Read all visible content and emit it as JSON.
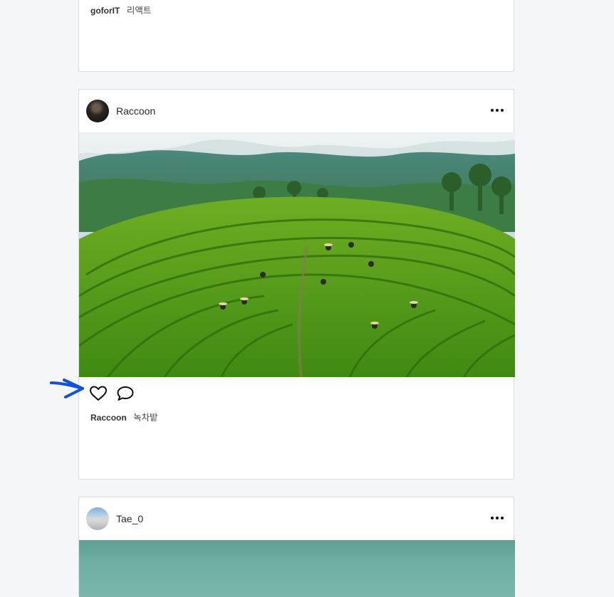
{
  "posts": [
    {
      "username": "goforIT",
      "caption_user": "goforIT",
      "caption_text": "리액트"
    },
    {
      "username": "Raccoon",
      "caption_user": "Raccoon",
      "caption_text": "녹차밭",
      "photo_subject": "terraced green tea field with workers and misty mountains",
      "avatar_icon": "raccoon-avatar"
    },
    {
      "username": "Tae_0",
      "avatar_icon": "tae-avatar",
      "photo_subject": "teal sky landscape (partially visible)"
    }
  ],
  "icons": {
    "more": "more-horizontal-icon",
    "like": "heart-outline-icon",
    "comment": "speech-bubble-icon",
    "annotation": "blue-arrow-annotation"
  },
  "colors": {
    "page_bg": "#f5f6f7",
    "card_border": "#dbdbdb",
    "annotation_arrow": "#1450d8"
  }
}
